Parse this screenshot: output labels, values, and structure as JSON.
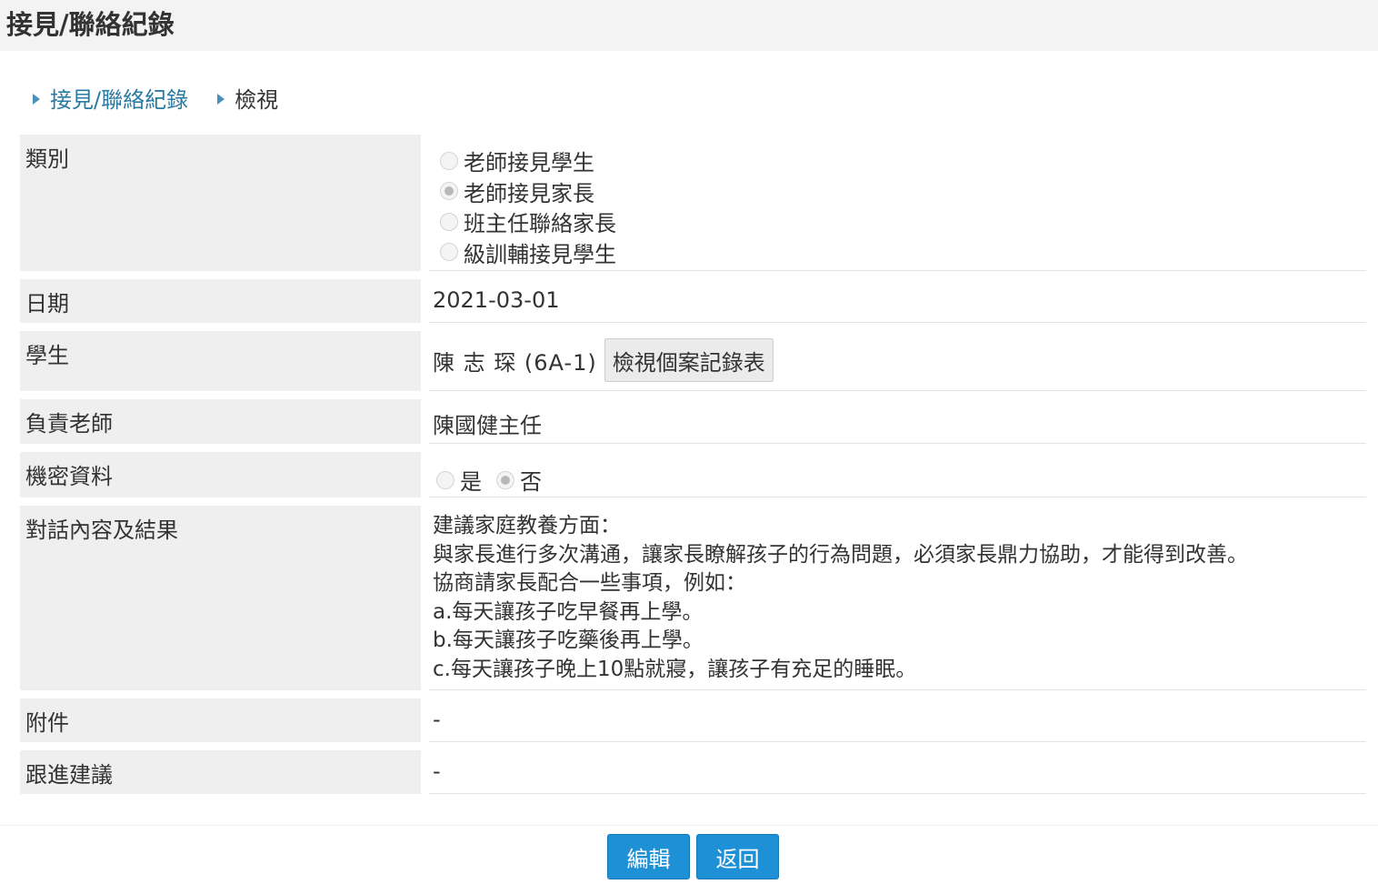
{
  "page": {
    "title": "接見/聯絡紀錄"
  },
  "breadcrumb": [
    {
      "label": "接見/聯絡紀錄"
    },
    {
      "label": "檢視"
    }
  ],
  "fields": {
    "type": {
      "label": "類別",
      "options": [
        {
          "label": "老師接見學生",
          "checked": false
        },
        {
          "label": "老師接見家長",
          "checked": true
        },
        {
          "label": "班主任聯絡家長",
          "checked": false
        },
        {
          "label": "級訓輔接見學生",
          "checked": false
        }
      ]
    },
    "date": {
      "label": "日期",
      "value": "2021-03-01"
    },
    "student": {
      "label": "學生",
      "value": "陳 志 琛 (6A-1)",
      "button_label": "檢視個案記錄表"
    },
    "teacher": {
      "label": "負責老師",
      "value": "陳國健主任"
    },
    "confidential": {
      "label": "機密資料",
      "options": [
        {
          "label": "是",
          "checked": false
        },
        {
          "label": "否",
          "checked": true
        }
      ]
    },
    "content": {
      "label": "對話內容及結果",
      "lines": [
        "建議家庭教養方面：",
        "與家長進行多次溝通，讓家長瞭解孩子的行為問題，必須家長鼎力協助，才能得到改善。",
        "協商請家長配合一些事項，例如：",
        "a.每天讓孩子吃早餐再上學。",
        "b.每天讓孩子吃藥後再上學。",
        "c.每天讓孩子晚上10點就寢，讓孩子有充足的睡眠。"
      ]
    },
    "attachment": {
      "label": "附件",
      "value": "-"
    },
    "followup": {
      "label": "跟進建議",
      "value": "-"
    }
  },
  "actions": {
    "edit_label": "編輯",
    "back_label": "返回"
  }
}
